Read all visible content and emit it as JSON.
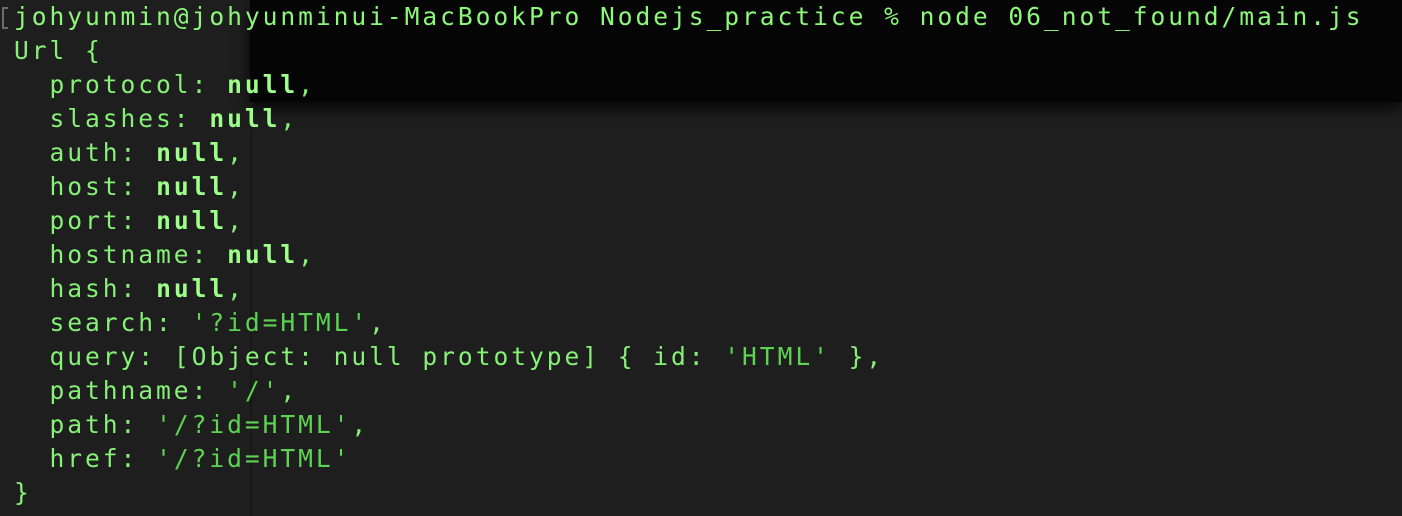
{
  "terminal": {
    "prompt": {
      "user_host": "johyunmin@johyunminui-MacBookPro",
      "directory": "Nodejs_practice",
      "symbol": "%",
      "command": "node 06_not_found/main.js"
    },
    "output": {
      "class_name": "Url",
      "open_brace": "{",
      "close_brace": "}",
      "fields": [
        {
          "key": "protocol",
          "value": "null",
          "kind": "null",
          "trailing": ","
        },
        {
          "key": "slashes",
          "value": "null",
          "kind": "null",
          "trailing": ","
        },
        {
          "key": "auth",
          "value": "null",
          "kind": "null",
          "trailing": ","
        },
        {
          "key": "host",
          "value": "null",
          "kind": "null",
          "trailing": ","
        },
        {
          "key": "port",
          "value": "null",
          "kind": "null",
          "trailing": ","
        },
        {
          "key": "hostname",
          "value": "null",
          "kind": "null",
          "trailing": ","
        },
        {
          "key": "hash",
          "value": "null",
          "kind": "null",
          "trailing": ","
        },
        {
          "key": "search",
          "value": "'?id=HTML'",
          "kind": "string",
          "trailing": ","
        },
        {
          "key": "query",
          "value_prefix": "[Object: null prototype] { id: ",
          "value": "'HTML'",
          "value_suffix": " }",
          "kind": "object",
          "trailing": ","
        },
        {
          "key": "pathname",
          "value": "'/'",
          "kind": "string",
          "trailing": ","
        },
        {
          "key": "path",
          "value": "'/?id=HTML'",
          "kind": "string",
          "trailing": ","
        },
        {
          "key": "href",
          "value": "'/?id=HTML'",
          "kind": "string",
          "trailing": ""
        }
      ]
    },
    "colors": {
      "background": "#1e1e1e",
      "text": "#86f077",
      "null_value": "#9dff8a",
      "string_value": "#5cd452"
    }
  }
}
